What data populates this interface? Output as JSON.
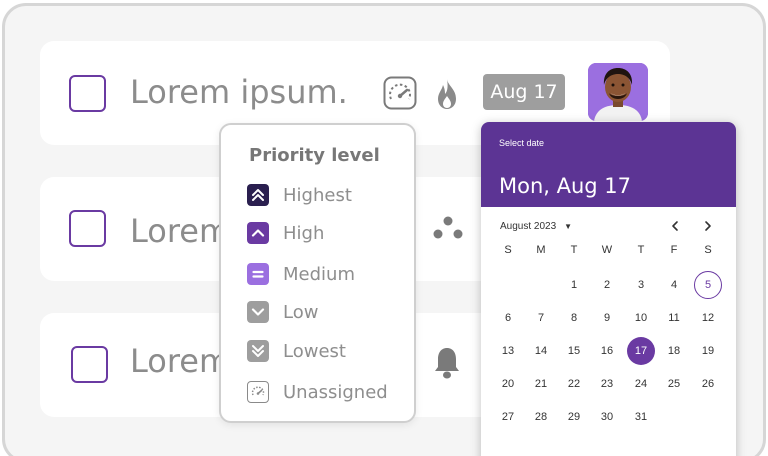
{
  "tasks": [
    {
      "title": "Lorem ipsum.",
      "checked": false
    },
    {
      "title": "Lorem",
      "checked": false
    },
    {
      "title": "Lorem",
      "checked": false
    }
  ],
  "task1": {
    "due_date": "Aug 17",
    "icons": [
      "priority-gauge-icon",
      "fire-icon"
    ],
    "assignee_avatar": "avatar"
  },
  "task2": {
    "icons": [
      "dots-cluster-icon"
    ]
  },
  "task3": {
    "icons": [
      "bell-icon"
    ]
  },
  "priority_menu": {
    "heading": "Priority level",
    "items": [
      {
        "label": "Highest",
        "icon": "double-chevron-up-icon",
        "color": "#2a1f4f"
      },
      {
        "label": "High",
        "icon": "chevron-up-icon",
        "color": "#6a3aa2"
      },
      {
        "label": "Medium",
        "icon": "equals-icon",
        "color": "#9b6fe0"
      },
      {
        "label": "Low",
        "icon": "chevron-down-icon",
        "color": "#9e9e9e"
      },
      {
        "label": "Lowest",
        "icon": "double-chevron-down-icon",
        "color": "#9e9e9e"
      },
      {
        "label": "Unassigned",
        "icon": "gauge-icon",
        "color": "#ffffff"
      }
    ]
  },
  "datepicker": {
    "select_label": "Select date",
    "selected_date": "Mon, Aug 17",
    "month_label": "August 2023",
    "weekdays": [
      "S",
      "M",
      "T",
      "W",
      "T",
      "F",
      "S"
    ],
    "weeks": [
      [
        "",
        "",
        "1",
        "2",
        "3",
        "4",
        "5"
      ],
      [
        "6",
        "7",
        "8",
        "9",
        "10",
        "11",
        "12"
      ],
      [
        "13",
        "14",
        "15",
        "16",
        "17",
        "18",
        "19"
      ],
      [
        "20",
        "21",
        "22",
        "23",
        "24",
        "25",
        "26"
      ],
      [
        "27",
        "28",
        "29",
        "30",
        "31",
        "",
        ""
      ]
    ],
    "today": "5",
    "selected": "17"
  },
  "colors": {
    "accent": "#6a3aa2",
    "header": "#5c3494",
    "chip": "#9e9e9e",
    "text_muted": "#8c8c8c"
  }
}
